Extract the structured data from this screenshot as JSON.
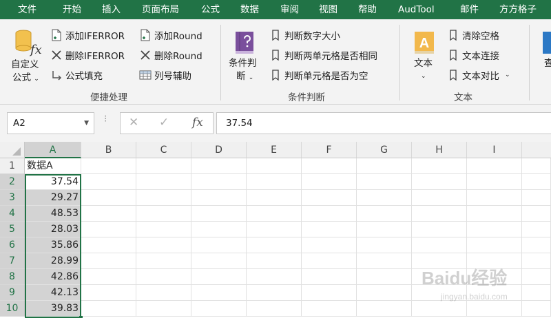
{
  "tabs": [
    "文件",
    "开始",
    "插入",
    "页面布局",
    "公式",
    "数据",
    "审阅",
    "视图",
    "帮助",
    "AudTool",
    "邮件",
    "方方格子"
  ],
  "ribbon": {
    "custom_formula": {
      "line1": "自定义",
      "line2": "公式"
    },
    "add_iferror": "添加IFERROR",
    "del_iferror": "删除IFERROR",
    "formula_fill": "公式填充",
    "add_round": "添加Round",
    "del_round": "删除Round",
    "col_helper": "列号辅助",
    "group_convenient": "便捷处理",
    "cond_judge": {
      "line1": "条件判",
      "line2": "断"
    },
    "judge_num_size": "判断数字大小",
    "judge_two_cells": "判断两单元格是否相同",
    "judge_cell_empty": "判断单元格是否为空",
    "group_cond": "条件判断",
    "text_big": "文本",
    "clear_spaces": "清除空格",
    "text_concat": "文本连接",
    "text_compare": "文本对比",
    "group_text": "文本",
    "partial_next": "查"
  },
  "formula_bar": {
    "name_box": "A2",
    "cancel_glyph": "✕",
    "enter_glyph": "✓",
    "fx_glyph": "fx",
    "formula": "37.54"
  },
  "columns": [
    "A",
    "B",
    "C",
    "D",
    "E",
    "F",
    "G",
    "H",
    "I"
  ],
  "rows": [
    "1",
    "2",
    "3",
    "4",
    "5",
    "6",
    "7",
    "8",
    "9",
    "10"
  ],
  "cells": {
    "A1": "数据A",
    "A_values": [
      "37.54",
      "29.27",
      "48.53",
      "28.03",
      "35.86",
      "28.99",
      "42.86",
      "42.13",
      "39.83"
    ]
  },
  "watermark": {
    "logo": "Baidu经验",
    "url": "jingyan.baidu.com"
  },
  "colors": {
    "accent": "#217346",
    "selection": "#d3d3d3"
  }
}
